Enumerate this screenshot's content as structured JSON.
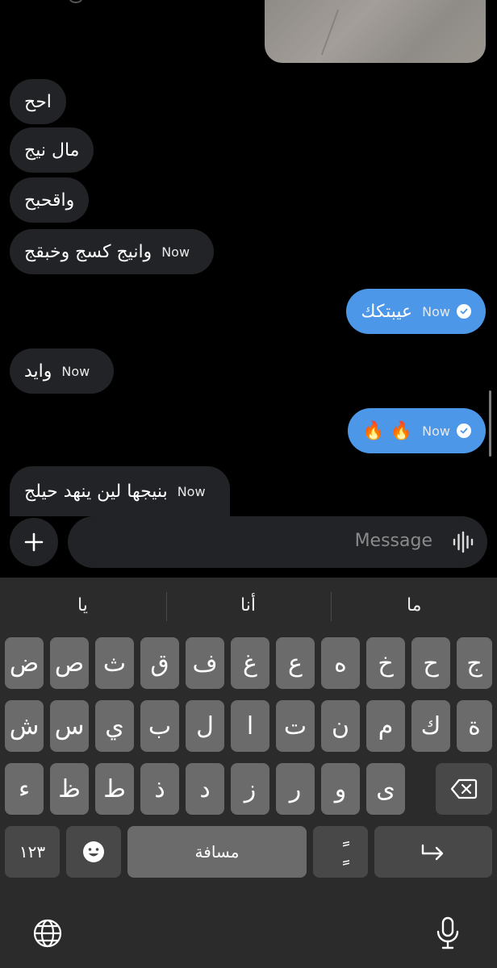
{
  "messages": [
    {
      "dir": "in",
      "text": "احح",
      "time": ""
    },
    {
      "dir": "in",
      "text": "مال نيج",
      "time": ""
    },
    {
      "dir": "in",
      "text": "واقحبح",
      "time": ""
    },
    {
      "dir": "in",
      "text": "وانيج كسج وخبقج",
      "time": "Now"
    },
    {
      "dir": "out",
      "text": "عيبتكك",
      "time": "Now"
    },
    {
      "dir": "in",
      "text": "وايد",
      "time": "Now"
    },
    {
      "dir": "out",
      "text": "🔥 🔥",
      "time": "Now"
    },
    {
      "dir": "in",
      "text": "بنيجها لين ينهد حيلج",
      "time": "Now"
    }
  ],
  "composer": {
    "placeholder": "Message"
  },
  "keyboard": {
    "suggestions": [
      "يا",
      "أنا",
      "ما"
    ],
    "row1": [
      "ض",
      "ص",
      "ث",
      "ق",
      "ف",
      "غ",
      "ع",
      "ه",
      "خ",
      "ح",
      "ج"
    ],
    "row2": [
      "ش",
      "س",
      "ي",
      "ب",
      "ل",
      "ا",
      "ت",
      "ن",
      "م",
      "ك",
      "ة"
    ],
    "row3": [
      "ء",
      "ظ",
      "ط",
      "ذ",
      "د",
      "ز",
      "ر",
      "و",
      "ى"
    ],
    "numbers_label": "١٢٣",
    "space_label": "مسافة",
    "tanween_label": "ًٍ"
  },
  "colors": {
    "incoming": "#212326",
    "outgoing": "#4c97e8",
    "keyboard": "#2b2b2b"
  }
}
